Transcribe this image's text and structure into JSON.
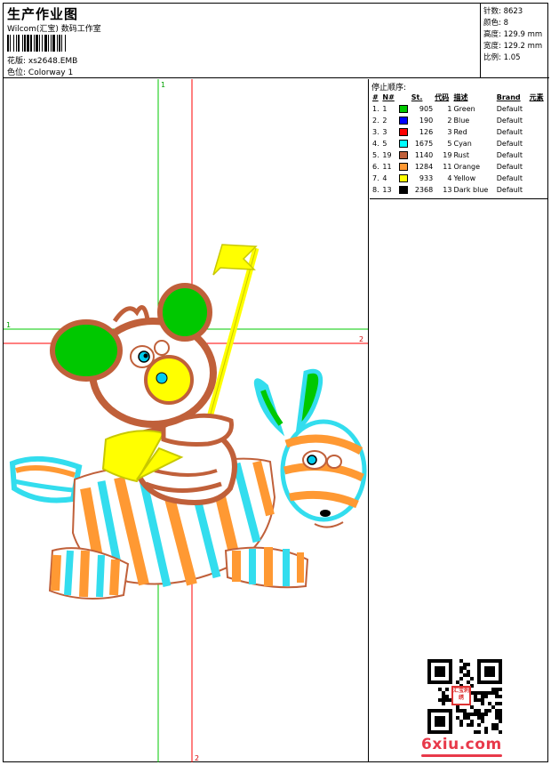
{
  "header": {
    "title": "生产作业图",
    "studio": "Wilcom(汇宝) 数码工作室",
    "design_label": "花版:",
    "design_value": "xs2648.EMB",
    "color_label": "色位:",
    "color_value": "Colorway 1"
  },
  "specs": [
    {
      "label": "针数:",
      "value": "8623"
    },
    {
      "label": "颜色:",
      "value": "8"
    },
    {
      "label": "高度:",
      "value": "129.9 mm"
    },
    {
      "label": "宽度:",
      "value": "129.2 mm"
    },
    {
      "label": "比例:",
      "value": "1.05"
    }
  ],
  "guides": {
    "v1": "1",
    "h1": "1",
    "h2": "2",
    "v2": "2"
  },
  "stop_sequence": {
    "title": "停止顺序:",
    "headers": {
      "index": "#",
      "needle": "N#",
      "stitches": "St.",
      "code": "代码",
      "desc": "描述",
      "brand": "Brand",
      "element": "元素"
    },
    "rows": [
      {
        "index": "1.",
        "needle": "1",
        "color": "#00c800",
        "stitches": "905",
        "code": "1",
        "desc": "Green",
        "brand": "Default"
      },
      {
        "index": "2.",
        "needle": "2",
        "color": "#0000ff",
        "stitches": "190",
        "code": "2",
        "desc": "Blue",
        "brand": "Default"
      },
      {
        "index": "3.",
        "needle": "3",
        "color": "#ff0000",
        "stitches": "126",
        "code": "3",
        "desc": "Red",
        "brand": "Default"
      },
      {
        "index": "4.",
        "needle": "5",
        "color": "#00ffff",
        "stitches": "1675",
        "code": "5",
        "desc": "Cyan",
        "brand": "Default"
      },
      {
        "index": "5.",
        "needle": "19",
        "color": "#c0603a",
        "stitches": "1140",
        "code": "19",
        "desc": "Rust",
        "brand": "Default"
      },
      {
        "index": "6.",
        "needle": "11",
        "color": "#ff9933",
        "stitches": "1284",
        "code": "11",
        "desc": "Orange",
        "brand": "Default"
      },
      {
        "index": "7.",
        "needle": "4",
        "color": "#ffff00",
        "stitches": "933",
        "code": "4",
        "desc": "Yellow",
        "brand": "Default"
      },
      {
        "index": "8.",
        "needle": "13",
        "color": "#000000",
        "stitches": "2368",
        "code": "13",
        "desc": "Dark blue",
        "brand": "Default"
      }
    ]
  },
  "qr_stamp": "汇宝刺绣",
  "brand_logo": "6xiu.com",
  "colors": {
    "guide_green": "#00c800",
    "guide_red": "#ff0000",
    "brand_red": "#e8394a"
  }
}
